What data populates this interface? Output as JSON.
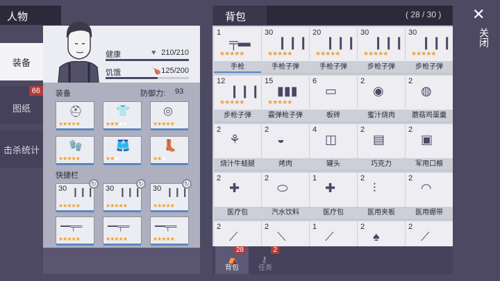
{
  "character": {
    "title": "人物",
    "tabs": {
      "equip": "装备",
      "blueprint": "图纸",
      "blueprint_badge": "66",
      "kills": "击杀统计"
    },
    "health_label": "健康",
    "health_value": "210/210",
    "health_fraction": 1.0,
    "hunger_label": "饥饿",
    "hunger_value": "125/200",
    "hunger_fraction": 0.625,
    "equipment_label": "装备",
    "defense_label": "防御力:",
    "defense_value": "93",
    "quickbar_label": "快捷栏",
    "quickbar_ammo": [
      "30",
      "30",
      "30"
    ]
  },
  "inventory": {
    "title": "背包",
    "capacity": "( 28 / 30 )",
    "items": [
      {
        "qty": "1",
        "name": "手枪",
        "icon": "pistol-icon",
        "stars": 5
      },
      {
        "qty": "30",
        "name": "手枪子弹",
        "icon": "bullets-icon",
        "stars": 5
      },
      {
        "qty": "20",
        "name": "手枪子弹",
        "icon": "bullets-icon",
        "stars": 5
      },
      {
        "qty": "30",
        "name": "步枪子弹",
        "icon": "bullets-icon",
        "stars": 5
      },
      {
        "qty": "30",
        "name": "步枪子弹",
        "icon": "bullets-icon",
        "stars": 5
      },
      {
        "qty": "12",
        "name": "步枪子弹",
        "icon": "bullets-icon",
        "stars": 5
      },
      {
        "qty": "15",
        "name": "霰弹枪子弹",
        "icon": "shells-icon",
        "stars": 5
      },
      {
        "qty": "6",
        "name": "板砖",
        "icon": "brick-icon",
        "stars": 0
      },
      {
        "qty": "2",
        "name": "蜜汁烧肉",
        "icon": "roast-meat-icon",
        "stars": 0
      },
      {
        "qty": "2",
        "name": "蘑菇鸡蛋羹",
        "icon": "egg-custard-icon",
        "stars": 0
      },
      {
        "qty": "2",
        "name": "烧汁牛蛙腿",
        "icon": "frog-legs-icon",
        "stars": 0
      },
      {
        "qty": "2",
        "name": "烤肉",
        "icon": "grilled-meat-icon",
        "stars": 0
      },
      {
        "qty": "4",
        "name": "罐头",
        "icon": "can-icon",
        "stars": 0
      },
      {
        "qty": "2",
        "name": "巧克力",
        "icon": "chocolate-icon",
        "stars": 0
      },
      {
        "qty": "2",
        "name": "军用口粮",
        "icon": "ration-icon",
        "stars": 0
      },
      {
        "qty": "2",
        "name": "医疗包",
        "icon": "medkit-icon",
        "stars": 0
      },
      {
        "qty": "2",
        "name": "汽水饮料",
        "icon": "soda-icon",
        "stars": 0
      },
      {
        "qty": "1",
        "name": "医疗包",
        "icon": "medkit-icon",
        "stars": 0
      },
      {
        "qty": "2",
        "name": "医用夹板",
        "icon": "splint-icon",
        "stars": 0
      },
      {
        "qty": "2",
        "name": "医用绷带",
        "icon": "bandage-icon",
        "stars": 0
      },
      {
        "qty": "2",
        "name": "",
        "icon": "syringe-icon",
        "stars": 0
      },
      {
        "qty": "2",
        "name": "",
        "icon": "tube-icon",
        "stars": 0
      },
      {
        "qty": "1",
        "name": "",
        "icon": "stick-icon",
        "stars": 0
      },
      {
        "qty": "2",
        "name": "",
        "icon": "mushroom-icon",
        "stars": 0
      },
      {
        "qty": "2",
        "name": "",
        "icon": "rod-icon",
        "stars": 0
      }
    ],
    "bottom_tabs": [
      {
        "label": "背包",
        "badge": "28"
      },
      {
        "label": "任务",
        "badge": "2"
      }
    ]
  },
  "close_label": "关闭",
  "colors": {
    "star": "#f2a122",
    "accent_bar": "#5a86c5",
    "badge": "#b33a3a"
  }
}
